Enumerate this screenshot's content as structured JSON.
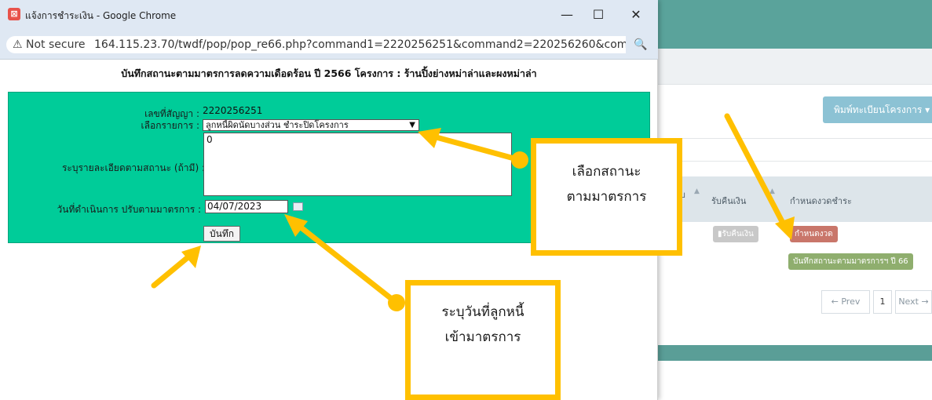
{
  "window": {
    "title": "แจ้งการชำระเงิน - Google Chrome",
    "minimize": "—",
    "maximize": "☐",
    "close": "✕",
    "app_icon": "xampp-icon"
  },
  "address_bar": {
    "security": "⚠ Not secure",
    "url": "164.115.23.70/twdf/pop/pop_re66.php?command1=2220256251&command2=220256260&comman...",
    "zoom": "🔍"
  },
  "form": {
    "heading": "บันทึกสถานะตามมาตรการลดความเดือดร้อน ปี 2566 โครงการ : ร้านปิ้งย่างหม่าล่าและผงหม่าล่า",
    "contract_label": "เลขที่สัญญา :",
    "contract_value": "2220256251",
    "item_label": "เลือกรายการ :",
    "item_selected": "ลูกหนี้ผิดนัดบางส่วน ชำระปิดโครงการ",
    "detail_label": "ระบุรายละเอียดตามสถานะ (ถ้ามี) :",
    "detail_value": "0",
    "date_label": "วันที่ดำเนินการ ปรับตามมาตรการ :",
    "date_value": "04/07/2023",
    "save_label": "บันทึก",
    "colors": {
      "panel": "#00cc99"
    }
  },
  "background_page": {
    "print_button": "พิมพ์ทะเบียนโครงการ ▾",
    "col_partial": "รับ",
    "col_refund": "รับคืนเงิน",
    "col_schedule": "กำหนดงวดชำระ",
    "refund_button": "รับคืนเงิน",
    "schedule_button": "กำหนดงวด",
    "record_button": "บันทึกสถานะตามมาตรการฯ ปี 66",
    "pager_prev": "← Prev",
    "pager_page": "1",
    "pager_next": "Next →"
  },
  "annotations": {
    "callout1_line1": "เลือกสถานะ",
    "callout1_line2": "ตามมาตรการ",
    "callout2_line1": "ระบุวันที่ลูกหนี้",
    "callout2_line2": "เข้ามาตรการ",
    "color": "#ffc000"
  }
}
